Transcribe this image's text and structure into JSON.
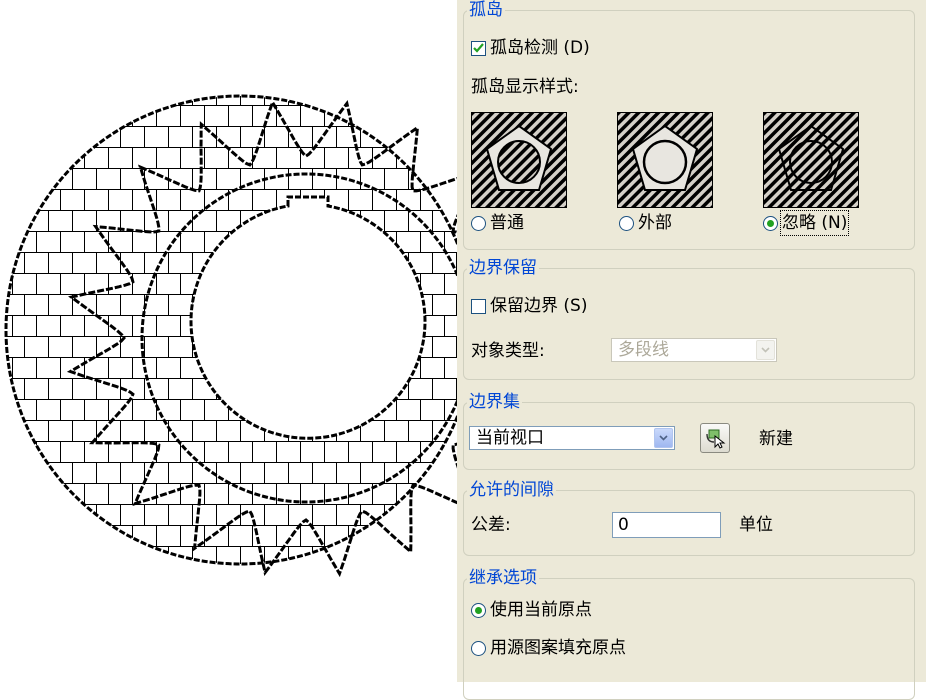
{
  "island": {
    "title": "孤岛",
    "detect_label": "孤岛检测 (D)",
    "detect_checked": true,
    "style_label": "孤岛显示样式:",
    "styles": [
      {
        "label": "普通",
        "selected": false
      },
      {
        "label": "外部",
        "selected": false
      },
      {
        "label": "忽略 (N)",
        "selected": true
      }
    ]
  },
  "boundary_retention": {
    "title": "边界保留",
    "retain_label": "保留边界 (S)",
    "retain_checked": false,
    "object_type_label": "对象类型:",
    "object_type_value": "多段线"
  },
  "boundary_set": {
    "title": "边界集",
    "value": "当前视口",
    "new_label": "新建"
  },
  "gap": {
    "title": "允许的间隙",
    "tolerance_label": "公差:",
    "tolerance_value": "0",
    "unit_label": "单位"
  },
  "inherit": {
    "title": "继承选项",
    "options": [
      {
        "label": "使用当前原点",
        "selected": true
      },
      {
        "label": "用源图案填充原点",
        "selected": false
      }
    ]
  },
  "colors": {
    "panel_bg": "#ece9d8",
    "group_title": "#0046d5",
    "radio_dot": "#21a121",
    "check_mark": "#21a121"
  }
}
